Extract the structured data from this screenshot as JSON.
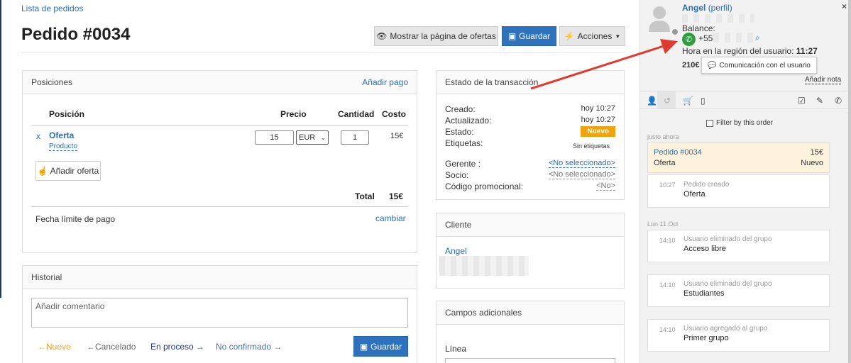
{
  "breadcrumb": "Lista de pedidos",
  "title": "Pedido #0034",
  "toolbar": {
    "show_offers": "Mostrar la página de ofertas",
    "save": "Guardar",
    "actions": "Acciones"
  },
  "positions": {
    "title": "Posiciones",
    "add_payment": "Añadir pago",
    "headers": {
      "position": "Posición",
      "price": "Precio",
      "quantity": "Cantidad",
      "cost": "Costo"
    },
    "row": {
      "remove": "x",
      "name": "Oferta",
      "type": "Producto",
      "price": "15",
      "currency": "EUR",
      "quantity": "1",
      "cost": "15€"
    },
    "add_offer": "Añadir oferta",
    "total_label": "Total",
    "total_value": "15€",
    "deadline_label": "Fecha límite de pago",
    "change": "cambiar"
  },
  "history": {
    "title": "Historial",
    "comment_placeholder": "Añadir comentario",
    "statuses": [
      "Nuevo",
      "Cancelado",
      "En proceso",
      "No confirmado"
    ],
    "save": "Guardar"
  },
  "transaction": {
    "title": "Estado de la transacción",
    "created_label": "Creado:",
    "created_value": "hoy 10:27",
    "updated_label": "Actualizado:",
    "updated_value": "hoy 10:27",
    "status_label": "Estado:",
    "status_value": "Nuevo",
    "tags_label": "Etiquetas:",
    "tags_value": "Sin etiquetas",
    "manager_label": "Gerente :",
    "manager_value": "<No seleccionado>",
    "partner_label": "Socio:",
    "partner_value": "<No seleccionado>",
    "promo_label": "Código promocional:",
    "promo_value": "<No>"
  },
  "client": {
    "title": "Cliente",
    "name": "Angel"
  },
  "extra_fields": {
    "title": "Campos adicionales",
    "line_label": "Línea"
  },
  "sidebar": {
    "user_name": "Angel",
    "profile": "(perfil)",
    "balance_label": "Balance:",
    "phone_prefix": "+55",
    "region_time_label": "Hora en la región del usuario:",
    "region_time_value": "11:27",
    "amount": "210€",
    "tooltip": "Comunicación con el usuario",
    "add_note": "Añadir nota",
    "filter_label": "Filter by this order",
    "just_now": "justo ahora",
    "order_card": {
      "title": "Pedido #0034",
      "price": "15€",
      "item": "Oferta",
      "status": "Nuevo"
    },
    "events": [
      {
        "time": "10:27",
        "label": "Pedido creado",
        "value": "Oferta"
      },
      {
        "time": "14:10",
        "label": "Usuario eliminado del grupo",
        "value": "Acceso libre"
      },
      {
        "time": "14:10",
        "label": "Usuario eliminado del grupo",
        "value": "Estudiantes"
      },
      {
        "time": "14:10",
        "label": "Usuario agregado al grupo",
        "value": "Primer grupo"
      }
    ],
    "date_separator": "Lun 11 Oct"
  },
  "colors": {
    "accent": "#2d72bf",
    "status_new": "#f0a30a",
    "arrow": "#e03a2f",
    "phone": "#2e9e3e"
  }
}
